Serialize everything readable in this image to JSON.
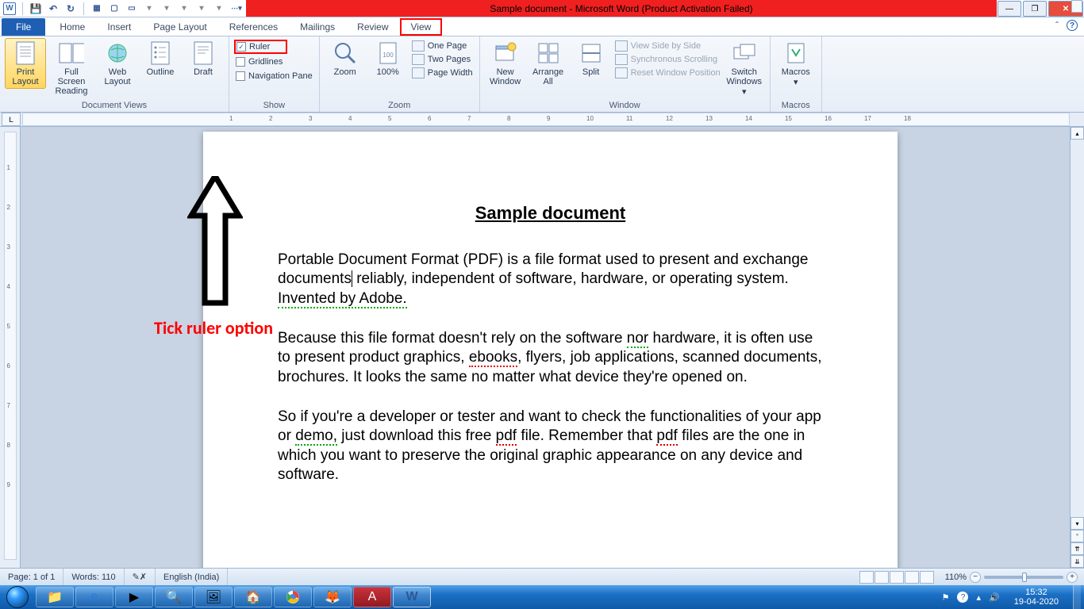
{
  "title_bar": {
    "title": "Sample document  -  Microsoft Word (Product Activation Failed)"
  },
  "tabs": {
    "file": "File",
    "items": [
      "Home",
      "Insert",
      "Page Layout",
      "References",
      "Mailings",
      "Review",
      "View"
    ],
    "active": "View"
  },
  "ribbon": {
    "views": {
      "label": "Document Views",
      "print": "Print Layout",
      "full": "Full Screen Reading",
      "web": "Web Layout",
      "outline": "Outline",
      "draft": "Draft"
    },
    "show": {
      "label": "Show",
      "ruler": "Ruler",
      "gridlines": "Gridlines",
      "nav": "Navigation Pane"
    },
    "zoom": {
      "label": "Zoom",
      "zoom": "Zoom",
      "pct": "100%",
      "one": "One Page",
      "two": "Two Pages",
      "pw": "Page Width"
    },
    "window": {
      "label": "Window",
      "neww": "New Window",
      "arr": "Arrange All",
      "split": "Split",
      "sbs": "View Side by Side",
      "sync": "Synchronous Scrolling",
      "reset": "Reset Window Position",
      "switch": "Switch Windows"
    },
    "macros": {
      "label": "Macros",
      "macros": "Macros"
    }
  },
  "annotation": {
    "text": "Tick ruler option"
  },
  "document": {
    "heading": "Sample document",
    "p1a": "Portable Document Format (PDF) is a file format used to present and exchange documents",
    "p1b": " reliably, independent of software, hardware, or operating system. ",
    "p1c": "Invented by Adobe.",
    "p2a": "Because this file format doesn't rely on the software ",
    "p2nor": "nor",
    "p2b": " hardware, it is often use to present product graphics, ",
    "p2eb": "ebooks",
    "p2c": ", flyers, job applications, scanned documents, brochures. It looks the same no matter what device they're opened on.",
    "p3a": "So if you're a developer or tester and want to check the functionalities of your app or ",
    "p3demo": "demo,",
    "p3b": " just download this free ",
    "p3pdf1": "pdf",
    "p3c": " file. Remember that ",
    "p3pdf2": "pdf",
    "p3d": " files are the one in which you want to preserve the original graphic appearance on any device and software."
  },
  "status": {
    "page": "Page: 1 of 1",
    "words": "Words: 110",
    "lang": "English (India)",
    "zoom": "110%"
  },
  "tray": {
    "time": "15:32",
    "date": "19-04-2020"
  }
}
